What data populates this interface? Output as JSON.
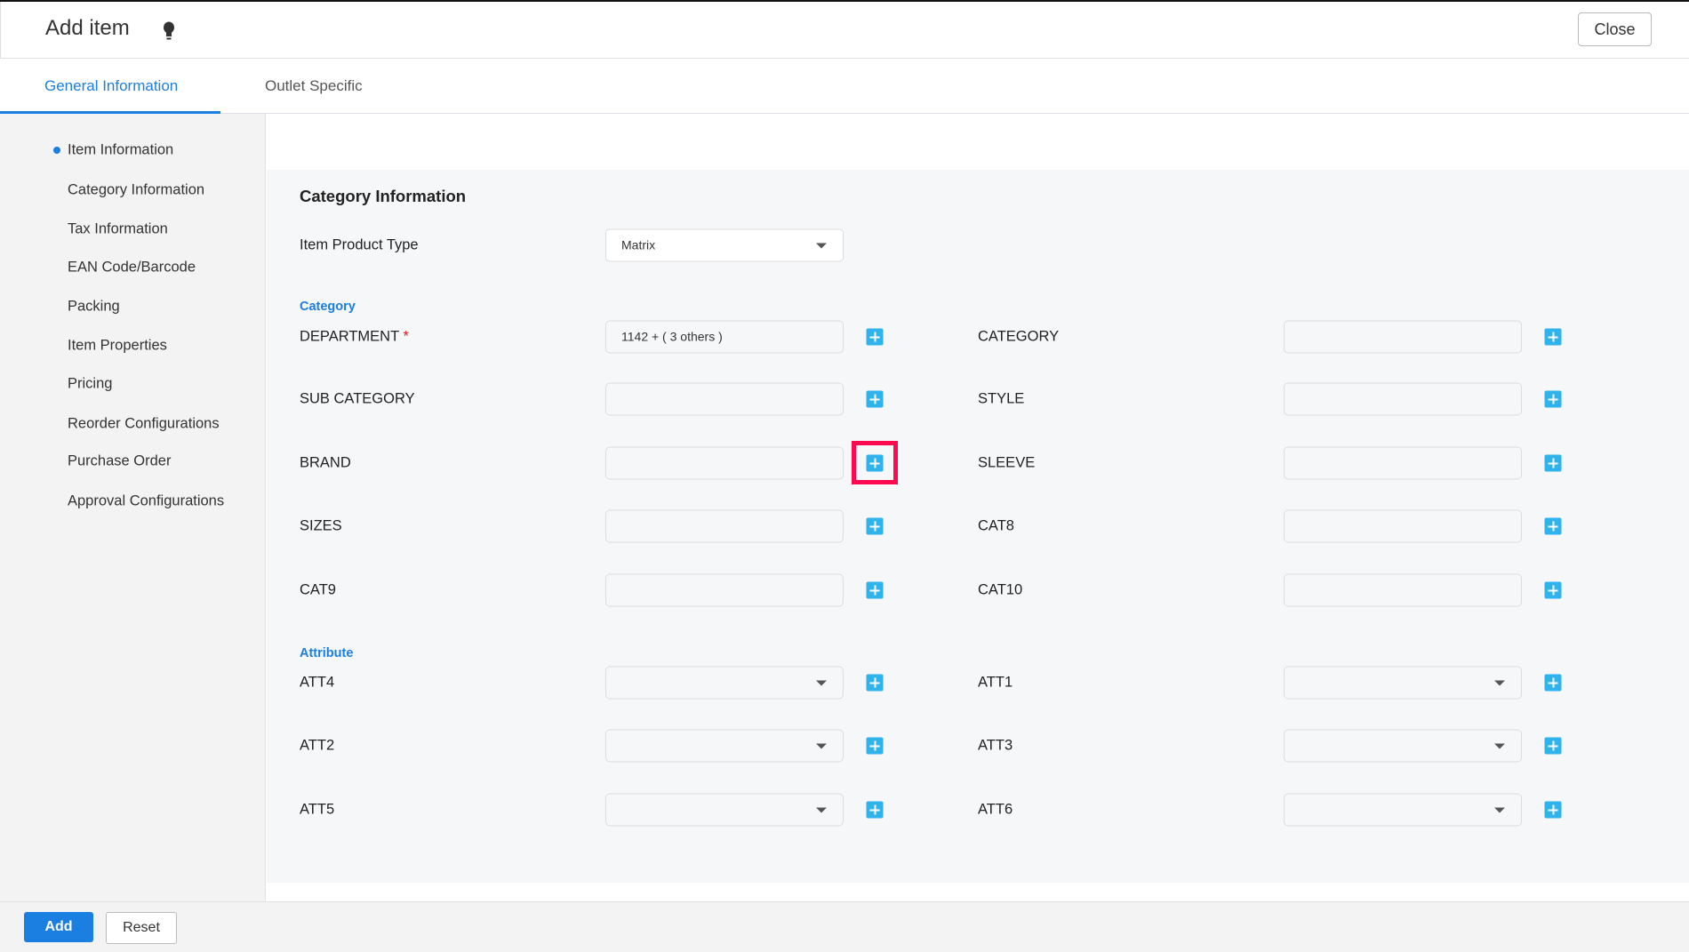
{
  "header": {
    "title": "Add item",
    "close_label": "Close"
  },
  "tabs": [
    {
      "label": "General Information",
      "active": true
    },
    {
      "label": "Outlet Specific",
      "active": false
    }
  ],
  "sidebar": {
    "items": [
      "Item Information",
      "Category Information",
      "Tax Information",
      "EAN Code/Barcode",
      "Packing",
      "Item Properties",
      "Pricing",
      "Reorder Configurations",
      "Purchase Order",
      "Approval Configurations"
    ],
    "active_index": 0
  },
  "section": {
    "title": "Category Information",
    "product_type_label": "Item Product Type",
    "product_type_value": "Matrix",
    "category_group": "Category",
    "attribute_group": "Attribute",
    "required_mark": "*",
    "category_rows": [
      [
        {
          "label": "DEPARTMENT",
          "value": "1142 + ( 3 others )",
          "required": true
        },
        {
          "label": "CATEGORY",
          "value": ""
        }
      ],
      [
        {
          "label": "SUB CATEGORY",
          "value": ""
        },
        {
          "label": "STYLE",
          "value": ""
        }
      ],
      [
        {
          "label": "BRAND",
          "value": "",
          "highlighted": true
        },
        {
          "label": "SLEEVE",
          "value": ""
        }
      ],
      [
        {
          "label": "SIZES",
          "value": ""
        },
        {
          "label": "CAT8",
          "value": ""
        }
      ],
      [
        {
          "label": "CAT9",
          "value": ""
        },
        {
          "label": "CAT10",
          "value": ""
        }
      ]
    ],
    "attribute_rows": [
      [
        {
          "label": "ATT4",
          "value": ""
        },
        {
          "label": "ATT1",
          "value": ""
        }
      ],
      [
        {
          "label": "ATT2",
          "value": ""
        },
        {
          "label": "ATT3",
          "value": ""
        }
      ],
      [
        {
          "label": "ATT5",
          "value": ""
        },
        {
          "label": "ATT6",
          "value": ""
        }
      ]
    ]
  },
  "footer": {
    "add_label": "Add",
    "reset_label": "Reset"
  },
  "colors": {
    "accent": "#1a7fe0",
    "plus": "#2fb3ec",
    "highlight": "#ff0a50"
  }
}
